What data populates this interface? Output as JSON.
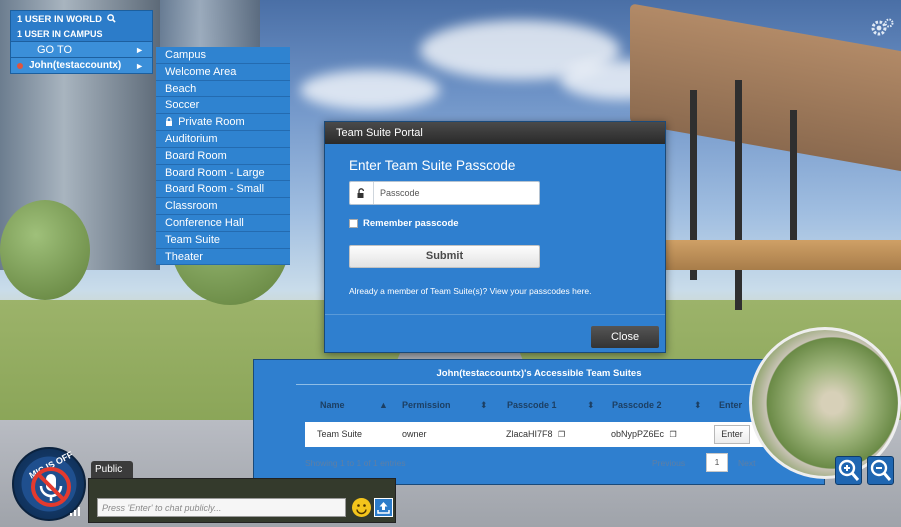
{
  "user_panel": {
    "users_in_world": "1 USER IN WORLD",
    "users_in_campus": "1 USER IN CAMPUS",
    "goto_label": "GO TO",
    "username": "John(testaccountx)"
  },
  "rooms": [
    {
      "label": "Campus",
      "locked": false
    },
    {
      "label": "Welcome Area",
      "locked": false
    },
    {
      "label": "Beach",
      "locked": false
    },
    {
      "label": "Soccer",
      "locked": false
    },
    {
      "label": "Private Room",
      "locked": true
    },
    {
      "label": "Auditorium",
      "locked": false
    },
    {
      "label": "Board Room",
      "locked": false
    },
    {
      "label": "Board Room - Large",
      "locked": false
    },
    {
      "label": "Board Room - Small",
      "locked": false
    },
    {
      "label": "Classroom",
      "locked": false
    },
    {
      "label": "Conference Hall",
      "locked": false
    },
    {
      "label": "Team Suite",
      "locked": false
    },
    {
      "label": "Theater",
      "locked": false
    }
  ],
  "portal": {
    "title": "Team Suite Portal",
    "heading": "Enter Team Suite Passcode",
    "passcode_placeholder": "Passcode",
    "remember_label": "Remember passcode",
    "submit_label": "Submit",
    "member_link": "Already a member of Team Suite(s)? View your passcodes here.",
    "close_label": "Close"
  },
  "suites": {
    "title": "John(testaccountx)'s Accessible Team Suites",
    "close_glyph": "×",
    "columns": [
      "Name",
      "Permission",
      "Passcode 1",
      "Passcode 2",
      "Enter"
    ],
    "rows": [
      {
        "name": "Team Suite",
        "permission": "owner",
        "passcode1": "ZlacaHI7F8",
        "passcode2": "obNypPZ6Ec",
        "enter_label": "Enter"
      }
    ],
    "showing": "Showing 1 to 1 of 1 entries",
    "previous": "Previous",
    "page": "1",
    "next": "Next"
  },
  "chat": {
    "mic_label": "MIC IS OFF",
    "tab_label": "Public",
    "input_placeholder": "Press 'Enter' to chat publicly..."
  },
  "colors": {
    "panel_blue": "#2f7fcf",
    "menu_blue": "#3b8fd9",
    "titlebar_dark": "#2a2a2a"
  }
}
